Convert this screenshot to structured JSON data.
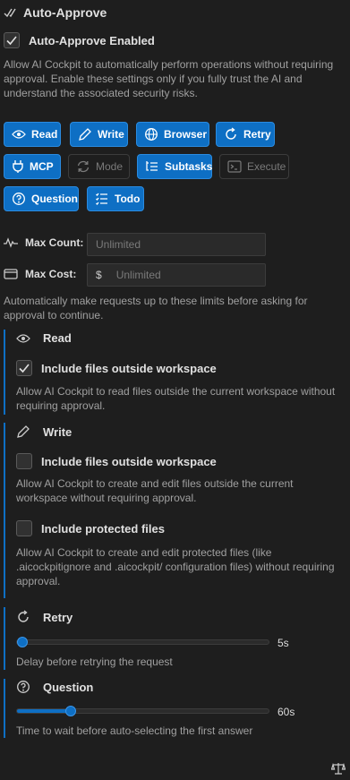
{
  "header": {
    "title": "Auto-Approve"
  },
  "enabled": {
    "label": "Auto-Approve Enabled",
    "checked": true
  },
  "intro": "Allow AI Cockpit to automatically perform operations without requiring approval. Enable these settings only if you fully trust the AI and understand the associated security risks.",
  "toggles": [
    {
      "label": "Read",
      "icon": "eye-icon",
      "active": true
    },
    {
      "label": "Write",
      "icon": "pencil-icon",
      "active": true
    },
    {
      "label": "Browser",
      "icon": "globe-icon",
      "active": true
    },
    {
      "label": "Retry",
      "icon": "refresh-icon",
      "active": true
    },
    {
      "label": "MCP",
      "icon": "plug-icon",
      "active": true
    },
    {
      "label": "Mode",
      "icon": "sync-icon",
      "active": false
    },
    {
      "label": "Subtasks",
      "icon": "subtasks-icon",
      "active": true
    },
    {
      "label": "Execute",
      "icon": "terminal-icon",
      "active": false
    },
    {
      "label": "Question",
      "icon": "question-icon",
      "active": true
    },
    {
      "label": "Todo",
      "icon": "checklist-icon",
      "active": true
    }
  ],
  "limits": {
    "max_count_label": "Max Count:",
    "max_count_placeholder": "Unlimited",
    "max_cost_label": "Max Cost:",
    "currency": "$",
    "max_cost_placeholder": "Unlimited",
    "description": "Automatically make requests up to these limits before asking for approval to continue."
  },
  "read_section": {
    "title": "Read",
    "outside_label": "Include files outside workspace",
    "outside_checked": true,
    "outside_desc": "Allow AI Cockpit to read files outside the current workspace without requiring approval."
  },
  "write_section": {
    "title": "Write",
    "outside_label": "Include files outside workspace",
    "outside_checked": false,
    "outside_desc": "Allow AI Cockpit to create and edit files outside the current workspace without requiring approval.",
    "protected_label": "Include protected files",
    "protected_checked": false,
    "protected_desc": "Allow AI Cockpit to create and edit protected files (like .aicockpitignore and .aicockpit/ configuration files) without requiring approval."
  },
  "retry_section": {
    "title": "Retry",
    "value": "5s",
    "fraction": 0.0,
    "desc": "Delay before retrying the request"
  },
  "question_section": {
    "title": "Question",
    "value": "60s",
    "fraction": 0.2,
    "desc": "Time to wait before auto-selecting the first answer"
  },
  "footer": {
    "icon": "scale-icon"
  }
}
